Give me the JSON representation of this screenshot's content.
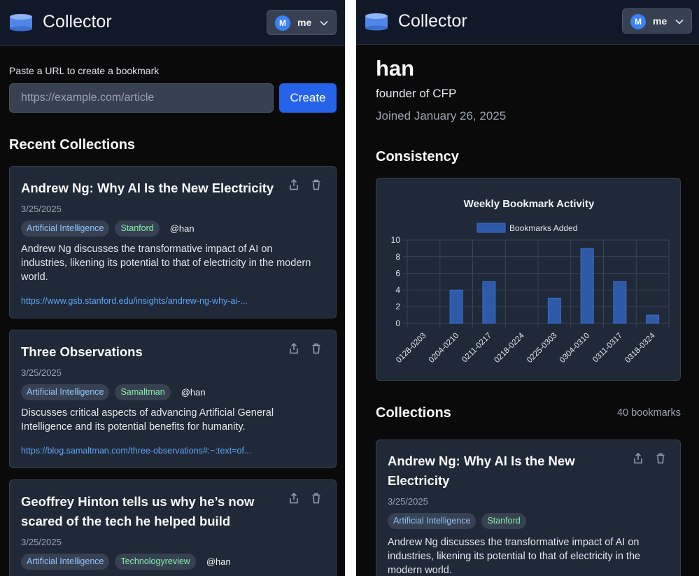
{
  "header": {
    "app_title": "Collector",
    "user": {
      "initial": "M",
      "label": "me"
    }
  },
  "left": {
    "url_label": "Paste a URL to create a bookmark",
    "url_placeholder": "https://example.com/article",
    "create_label": "Create",
    "recent_title": "Recent Collections",
    "cards": [
      {
        "title": "Andrew Ng: Why AI Is the New Electricity",
        "date": "3/25/2025",
        "tags": [
          "Artificial Intelligence",
          "Stanford"
        ],
        "user": "@han",
        "description_lines": [
          "Andrew Ng discusses the transformative impact of AI on",
          "industries, likening its potential to that of electricity in the modern",
          "world."
        ],
        "link": "https://www.gsb.stanford.edu/insights/andrew-ng-why-ai-..."
      },
      {
        "title": "Three Observations",
        "date": "3/25/2025",
        "tags": [
          "Artificial Intelligence",
          "Samaltman"
        ],
        "user": "@han",
        "description_lines": [
          "Discusses critical aspects of advancing Artificial General",
          "Intelligence and its potential benefits for humanity."
        ],
        "link": "https://blog.samaltman.com/three-observations#:~:text=of..."
      },
      {
        "title_lines": [
          "Geoffrey Hinton tells us why he’s now",
          "scared of the tech he helped build"
        ],
        "date": "3/25/2025",
        "tags": [
          "Artificial Intelligence",
          "Technologyreview"
        ],
        "user": "@han"
      }
    ]
  },
  "right": {
    "profile_name": "han",
    "bio": "founder of CFP",
    "joined": "Joined January 26, 2025",
    "consistency_title": "Consistency",
    "collections_title": "Collections",
    "bookmark_count": "40 bookmarks",
    "card": {
      "title_lines": [
        "Andrew Ng: Why AI Is the New",
        "Electricity"
      ],
      "date": "3/25/2025",
      "tags": [
        "Artificial Intelligence",
        "Stanford"
      ],
      "description_lines": [
        "Andrew Ng discusses the transformative impact of AI on",
        "industries, likening its potential to that of electricity in the",
        "modern world."
      ]
    }
  },
  "chart_data": {
    "type": "bar",
    "title": "Weekly Bookmark Activity",
    "categories": [
      "0128-0203",
      "0204-0210",
      "0211-0217",
      "0218-0224",
      "0225-0303",
      "0304-0310",
      "0311-0317",
      "0318-0324"
    ],
    "series": [
      {
        "name": "Bookmarks Added",
        "values": [
          0,
          4,
          5,
          0,
          3,
          9,
          5,
          1
        ]
      }
    ],
    "ylim": [
      0,
      10
    ],
    "yticks": [
      "0",
      "2",
      "4",
      "6",
      "8",
      "10"
    ],
    "grid": true,
    "legend": "top",
    "colors": {
      "bar_fill": "#2f5aa8",
      "bar_stroke": "#3b6fd0"
    }
  }
}
